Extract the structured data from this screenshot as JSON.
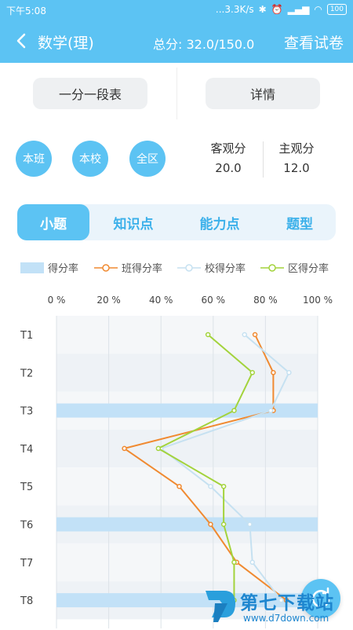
{
  "status": {
    "time": "下午5:08",
    "speed": "...3.3K/s",
    "battery": "100"
  },
  "header": {
    "title": "数学(理)",
    "total_score": "总分: 32.0/150.0",
    "view_paper": "查看试卷"
  },
  "buttons": {
    "segment_table": "一分一段表",
    "details": "详情"
  },
  "scope": {
    "class": "本班",
    "school": "本校",
    "district": "全区"
  },
  "stats": {
    "objective_label": "客观分",
    "objective_value": "20.0",
    "subjective_label": "主观分",
    "subjective_value": "12.0"
  },
  "tabs": [
    "小题",
    "知识点",
    "能力点",
    "题型"
  ],
  "legend": {
    "score_rate": "得分率",
    "class_rate": "班得分率",
    "school_rate": "校得分率",
    "district_rate": "区得分率"
  },
  "colors": {
    "primary": "#5cc3f3",
    "bar": "#c2e1f7",
    "class_line": "#f08a31",
    "school_line": "#c6e1f1",
    "district_line": "#a3d33c"
  },
  "watermark": {
    "brand": "第七下载站",
    "url": "www.d7down.com"
  },
  "chart_data": {
    "type": "bar",
    "orientation": "horizontal",
    "categories": [
      "T1",
      "T2",
      "T3",
      "T4",
      "T5",
      "T6",
      "T7",
      "T8"
    ],
    "xticks": [
      "0 %",
      "20 %",
      "40 %",
      "60 %",
      "80 %",
      "100 %"
    ],
    "xlim": [
      0,
      100
    ],
    "series": [
      {
        "name": "得分率",
        "type": "bar",
        "values": [
          0,
          0,
          100,
          0,
          0,
          100,
          0,
          100
        ]
      },
      {
        "name": "班得分率",
        "type": "line",
        "values": [
          76,
          83,
          83,
          26,
          47,
          59,
          69,
          88
        ]
      },
      {
        "name": "校得分率",
        "type": "line",
        "values": [
          72,
          89,
          82,
          40,
          59,
          74,
          75,
          86
        ]
      },
      {
        "name": "区得分率",
        "type": "line",
        "values": [
          58,
          75,
          68,
          39,
          64,
          64,
          68,
          68
        ]
      }
    ]
  }
}
